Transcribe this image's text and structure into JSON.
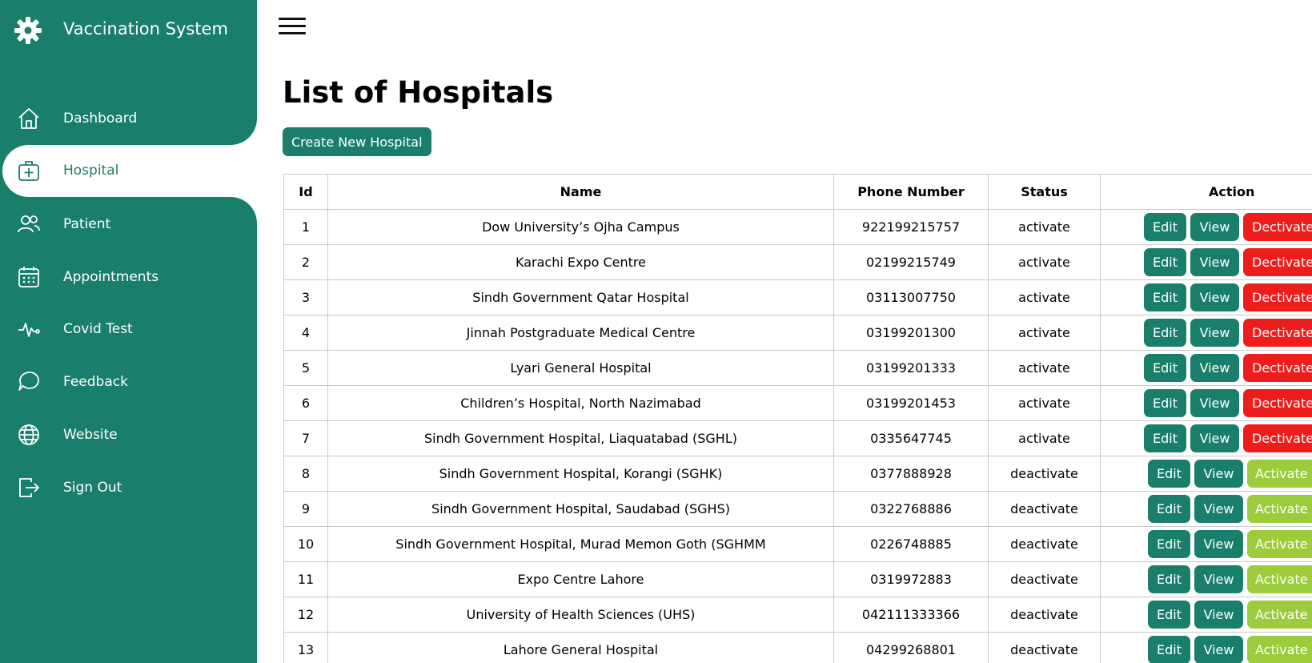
{
  "app": {
    "title": "Vaccination System",
    "logo_icon": "gear-icon"
  },
  "sidebar": {
    "items": [
      {
        "label": "Dashboard",
        "icon": "home-icon",
        "active": false
      },
      {
        "label": "Hospital",
        "icon": "medical-case-icon",
        "active": true
      },
      {
        "label": "Patient",
        "icon": "users-icon",
        "active": false
      },
      {
        "label": "Appointments",
        "icon": "calendar-icon",
        "active": false
      },
      {
        "label": "Covid Test",
        "icon": "pulse-icon",
        "active": false
      },
      {
        "label": "Feedback",
        "icon": "chat-bubble-icon",
        "active": false
      },
      {
        "label": "Website",
        "icon": "globe-icon",
        "active": false
      },
      {
        "label": "Sign Out",
        "icon": "sign-out-icon",
        "active": false
      }
    ]
  },
  "header": {
    "menu_icon": "hamburger-icon"
  },
  "main": {
    "title": "List of Hospitals",
    "create_button": "Create New Hospital",
    "table": {
      "columns": [
        "Id",
        "Name",
        "Phone Number",
        "Status",
        "Action"
      ],
      "rows": [
        {
          "id": "1",
          "name": "Dow University’s Ojha Campus",
          "phone": "922199215757",
          "status": "activate",
          "toggle": "Dectivate"
        },
        {
          "id": "2",
          "name": "Karachi Expo Centre",
          "phone": "02199215749",
          "status": "activate",
          "toggle": "Dectivate"
        },
        {
          "id": "3",
          "name": "Sindh Government Qatar Hospital",
          "phone": "03113007750",
          "status": "activate",
          "toggle": "Dectivate"
        },
        {
          "id": "4",
          "name": "Jinnah Postgraduate Medical Centre",
          "phone": "03199201300",
          "status": "activate",
          "toggle": "Dectivate"
        },
        {
          "id": "5",
          "name": "Lyari General Hospital",
          "phone": "03199201333",
          "status": "activate",
          "toggle": "Dectivate"
        },
        {
          "id": "6",
          "name": "Children’s Hospital, North Nazimabad",
          "phone": "03199201453",
          "status": "activate",
          "toggle": "Dectivate"
        },
        {
          "id": "7",
          "name": "Sindh Government Hospital, Liaquatabad (SGHL)",
          "phone": "0335647745",
          "status": "activate",
          "toggle": "Dectivate"
        },
        {
          "id": "8",
          "name": "Sindh Government Hospital, Korangi (SGHK)",
          "phone": "0377888928",
          "status": "deactivate",
          "toggle": "Activate"
        },
        {
          "id": "9",
          "name": "Sindh Government Hospital, Saudabad (SGHS)",
          "phone": "0322768886",
          "status": "deactivate",
          "toggle": "Activate"
        },
        {
          "id": "10",
          "name": "Sindh Government Hospital, Murad Memon Goth (SGHMM",
          "phone": "0226748885",
          "status": "deactivate",
          "toggle": "Activate"
        },
        {
          "id": "11",
          "name": "Expo Centre Lahore",
          "phone": "0319972883",
          "status": "deactivate",
          "toggle": "Activate"
        },
        {
          "id": "12",
          "name": "University of Health Sciences (UHS)",
          "phone": "042111333366",
          "status": "deactivate",
          "toggle": "Activate"
        },
        {
          "id": "13",
          "name": "Lahore General Hospital",
          "phone": "04299268801",
          "status": "deactivate",
          "toggle": "Activate"
        }
      ],
      "edit_label": "Edit",
      "view_label": "View"
    }
  },
  "colors": {
    "primary": "#1a7f6a",
    "deactivate": "#ef1c1c",
    "activate": "#9ccc3c",
    "border": "#c8c8c8"
  }
}
